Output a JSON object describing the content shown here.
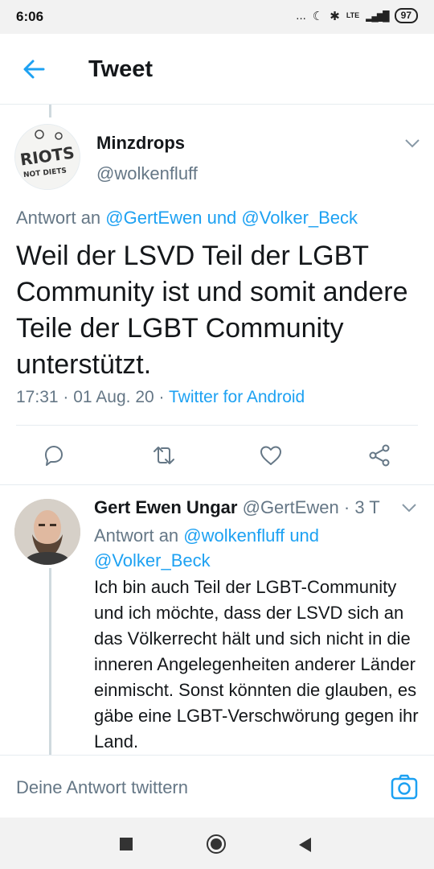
{
  "status_bar": {
    "time": "6:06",
    "dots": "...",
    "moon": "☾",
    "bluetooth": "✱",
    "network": "LTE",
    "signal": "▂▄▆█",
    "battery": "97"
  },
  "header": {
    "title": "Tweet"
  },
  "main_tweet": {
    "author_name": "Minzdrops",
    "author_handle": "@wolkenfluff",
    "avatar_text_1": "RIOTS",
    "avatar_text_2": "NOT DIETS",
    "reply_prefix": "Antwort an",
    "reply_user_1": "@GertEwen",
    "reply_conj": "und",
    "reply_user_2": "@Volker_Beck",
    "text": "Weil der LSVD Teil der LGBT Community ist und somit andere Teile der LGBT Community unterstützt.",
    "time": "17:31",
    "date": "01 Aug. 20",
    "separator": "·",
    "source": "Twitter for Android"
  },
  "reply_tweet": {
    "author_name": "Gert Ewen Ungar",
    "author_handle": "@GertEwen",
    "separator": "·",
    "age": "3 T",
    "reply_prefix": "Antwort an",
    "reply_user_1": "@wolkenfluff",
    "reply_conj": "und",
    "reply_user_2": "@Volker_Beck",
    "text": "Ich bin auch Teil der LGBT-Community und ich möchte, dass der LSVD sich an das Völkerrecht hält und sich nicht in die inneren Angelegenheiten anderer Länder einmischt. Sonst könnten die glauben, es gäbe eine LGBT-Verschwörung gegen ihr Land."
  },
  "composer": {
    "placeholder": "Deine Antwort twittern"
  },
  "icons": {
    "back": "arrow-left-icon",
    "caret": "chevron-down-icon",
    "reply": "reply-bubble-icon",
    "retweet": "retweet-icon",
    "like": "heart-icon",
    "share": "share-icon",
    "camera": "camera-icon"
  },
  "colors": {
    "accent": "#1da1f2",
    "secondary_text": "#657786",
    "primary_text": "#14171a",
    "divider": "#e6ecf0"
  }
}
